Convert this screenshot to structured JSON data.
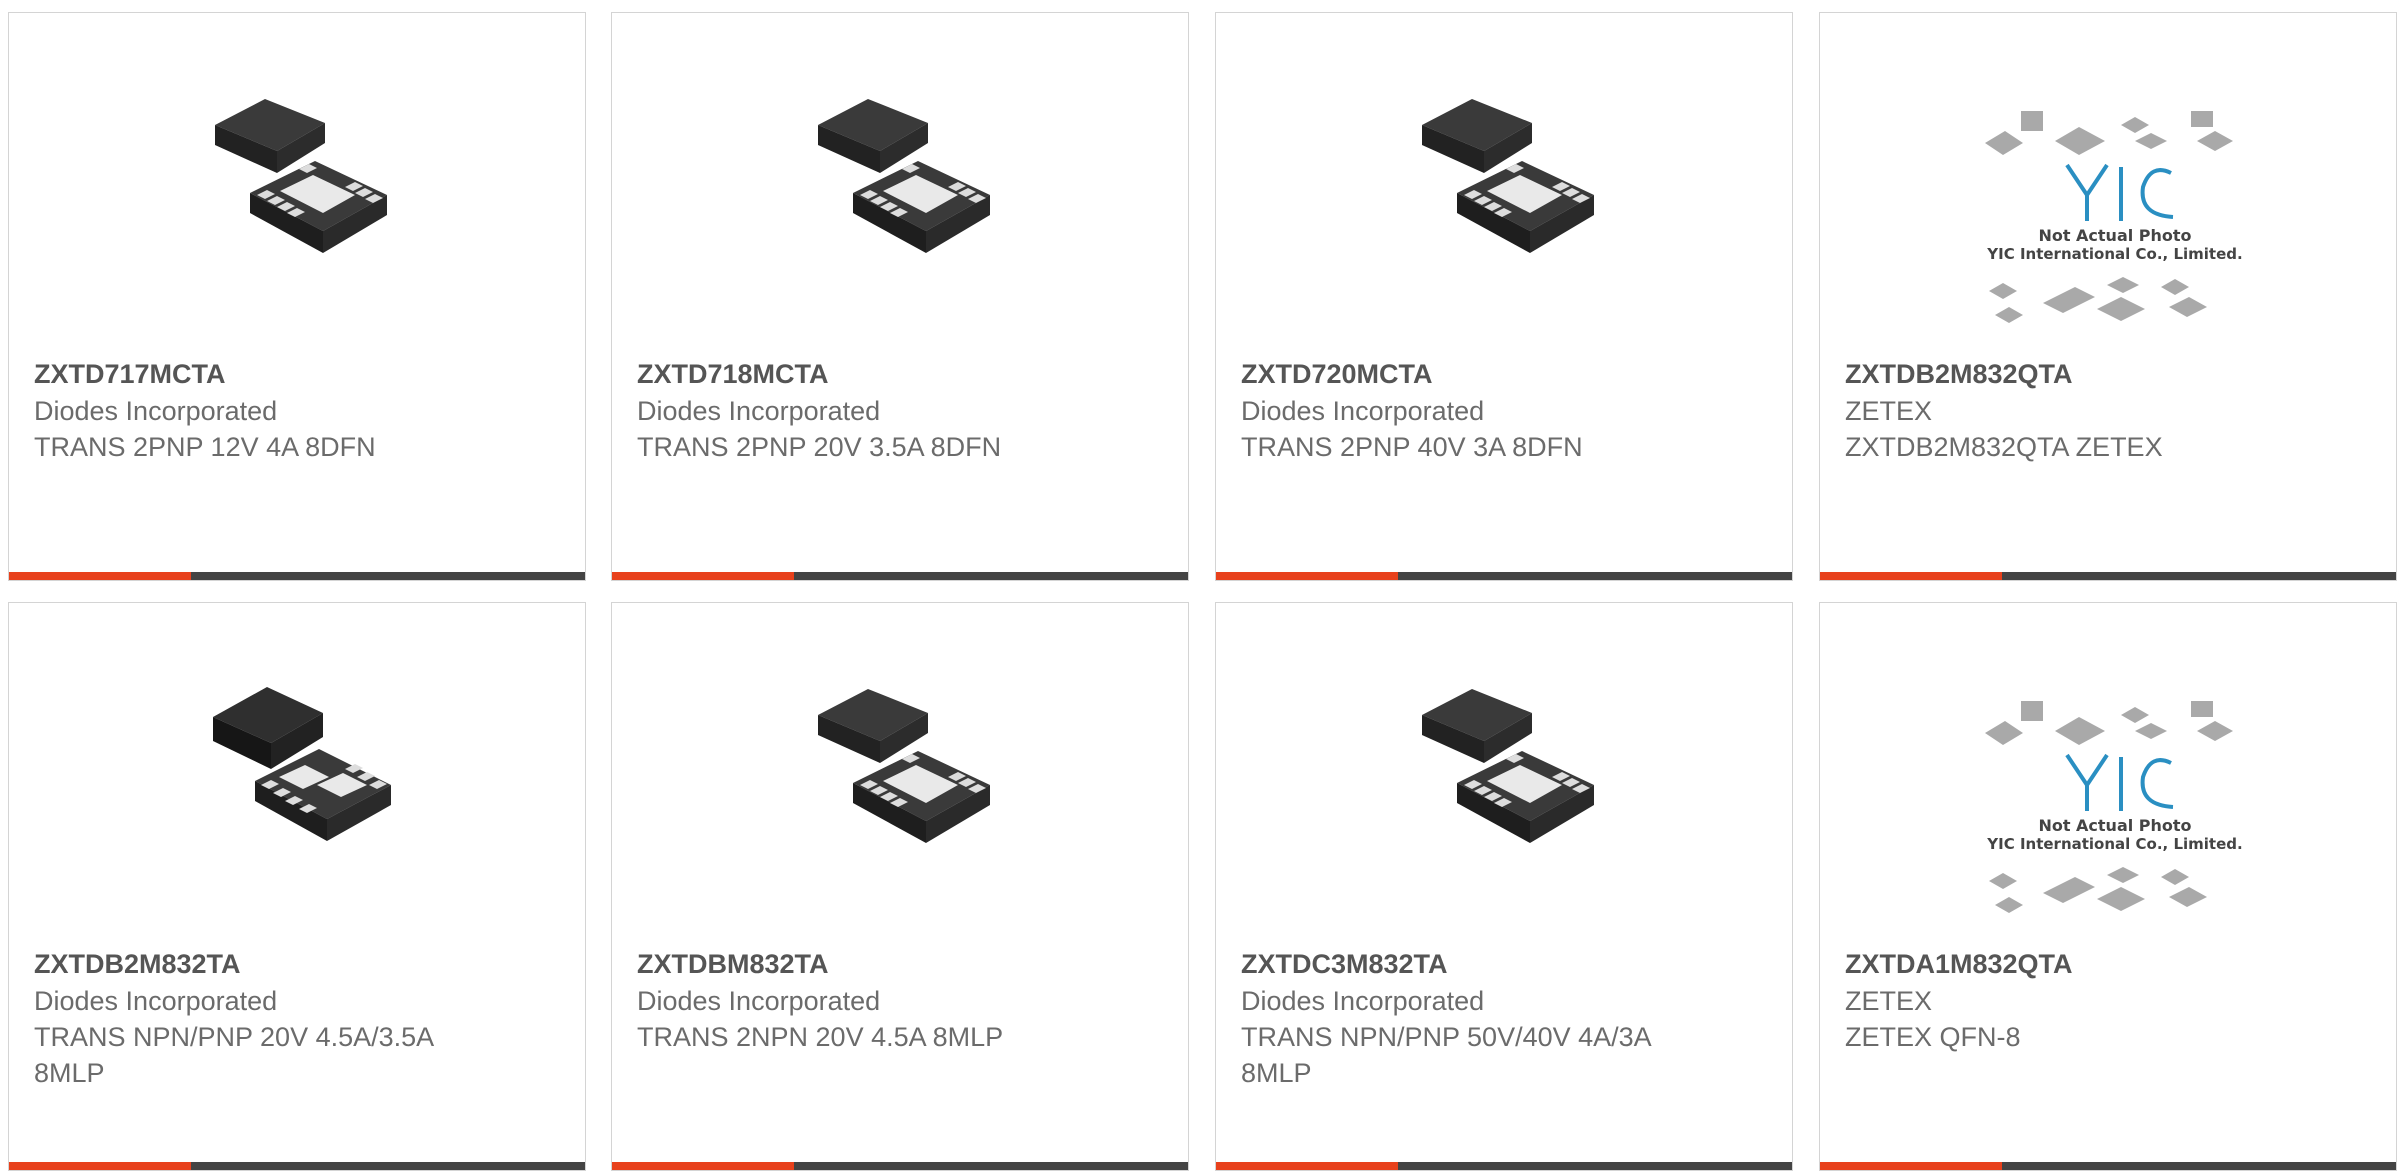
{
  "colors": {
    "accent": "#e8411c",
    "bar": "#444444",
    "title": "#555555",
    "text": "#6b6b6b",
    "border": "#d4d4d4"
  },
  "products": [
    {
      "part": "ZXTD717MCTA",
      "manufacturer": "Diodes Incorporated",
      "description": "TRANS 2PNP 12V 4A 8DFN",
      "image": "dfn-package-icon"
    },
    {
      "part": "ZXTD718MCTA",
      "manufacturer": "Diodes Incorporated",
      "description": "TRANS 2PNP 20V 3.5A 8DFN",
      "image": "dfn-package-icon"
    },
    {
      "part": "ZXTD720MCTA",
      "manufacturer": "Diodes Incorporated",
      "description": "TRANS 2PNP 40V 3A 8DFN",
      "image": "dfn-package-icon"
    },
    {
      "part": "ZXTDB2M832QTA",
      "manufacturer": "ZETEX",
      "description": "ZXTDB2M832QTA ZETEX",
      "image": "placeholder-photo-icon",
      "placeholder_line1": "Not Actual Photo",
      "placeholder_line2": "YIC International Co., Limited.",
      "placeholder_logo": "YIC"
    },
    {
      "part": "ZXTDB2M832TA",
      "manufacturer": "Diodes Incorporated",
      "description": "TRANS NPN/PNP 20V 4.5A/3.5A 8MLP",
      "image": "mlp-package-icon"
    },
    {
      "part": "ZXTDBM832TA",
      "manufacturer": "Diodes Incorporated",
      "description": "TRANS 2NPN 20V 4.5A 8MLP",
      "image": "dfn-package-icon"
    },
    {
      "part": "ZXTDC3M832TA",
      "manufacturer": "Diodes Incorporated",
      "description": "TRANS NPN/PNP 50V/40V 4A/3A 8MLP",
      "image": "dfn-package-icon"
    },
    {
      "part": "ZXTDA1M832QTA",
      "manufacturer": "ZETEX",
      "description": "ZETEX QFN-8",
      "image": "placeholder-photo-icon",
      "placeholder_line1": "Not Actual Photo",
      "placeholder_line2": "YIC International Co., Limited.",
      "placeholder_logo": "YIC"
    }
  ]
}
